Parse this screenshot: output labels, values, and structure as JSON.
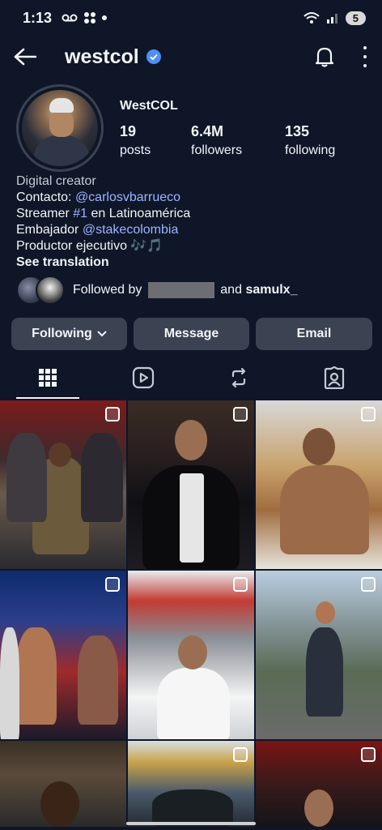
{
  "status_bar": {
    "time": "1:13",
    "icons_left": [
      "voicemail-icon",
      "apps-icon",
      "dot-icon"
    ],
    "icons_right": [
      "wifi-icon",
      "signal-icon"
    ],
    "battery": "5"
  },
  "header": {
    "username": "westcol",
    "verified": true
  },
  "profile": {
    "display_name": "WestCOL",
    "stats": [
      {
        "value": "19",
        "label": "posts"
      },
      {
        "value": "6.4M",
        "label": "followers"
      },
      {
        "value": "135",
        "label": "following"
      }
    ],
    "bio": {
      "category": "Digital creator",
      "line1_prefix": "Contacto: ",
      "line1_link": "@carlosvbarrueco",
      "line2_prefix": "Streamer ",
      "line2_link": "#1",
      "line2_suffix": " en Latinoamérica",
      "line3_prefix": "Embajador ",
      "line3_link": "@stakecolombia",
      "line4": "Productor ejecutivo 🎶🎵",
      "see_translation": "See translation"
    },
    "followed_by": {
      "prefix": "Followed by",
      "middle": "and",
      "name": "samulx_"
    }
  },
  "actions": {
    "following": "Following",
    "message": "Message",
    "email": "Email"
  },
  "tabs": [
    "grid-icon",
    "reels-icon",
    "reposts-icon",
    "tagged-icon"
  ],
  "colors": {
    "background": "#0e1628",
    "button": "#3b4252",
    "link": "#9fb3ff",
    "verified": "#4f8ef7"
  }
}
